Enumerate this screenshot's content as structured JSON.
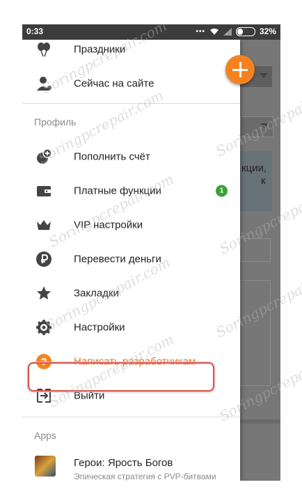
{
  "status_bar": {
    "time": "0:33",
    "battery": "32%"
  },
  "drawer": {
    "top_items": [
      {
        "label": "Праздники",
        "icon": "balloons-icon"
      },
      {
        "label": "Сейчас на сайте",
        "icon": "person-online-icon"
      }
    ],
    "profile_section": "Профиль",
    "profile_items": [
      {
        "label": "Пополнить счёт",
        "icon": "add-coin-icon"
      },
      {
        "label": "Платные функции",
        "icon": "wallet-icon",
        "badge": "1"
      },
      {
        "label": "VIP настройки",
        "icon": "crown-icon"
      },
      {
        "label": "Перевести деньги",
        "icon": "ruble-icon"
      },
      {
        "label": "Закладки",
        "icon": "star-icon"
      },
      {
        "label": "Настройки",
        "icon": "gear-icon"
      },
      {
        "label": "Написать разработчикам",
        "icon": "help-icon"
      },
      {
        "label": "Выйти",
        "icon": "exit-icon"
      }
    ],
    "apps_section": "Apps",
    "app": {
      "title": "Герои: Ярость Богов",
      "subtitle": "Эпическая стратегия с PVP-битвами"
    }
  },
  "background": {
    "card_text_line1": "кции,",
    "card_text_line2": "к"
  },
  "watermark": "Soringpcrepair.com",
  "colors": {
    "accent": "#f58220",
    "highlight_text": "#e8741e",
    "badge": "#3da13a",
    "frame": "#d9534f"
  }
}
